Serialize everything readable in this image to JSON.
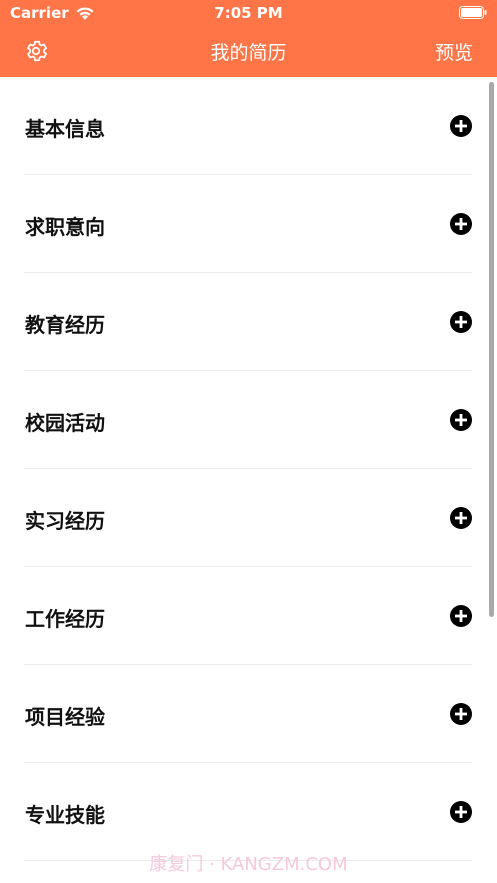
{
  "status_bar": {
    "carrier": "Carrier",
    "time": "7:05 PM"
  },
  "nav": {
    "title": "我的简历",
    "preview_label": "预览"
  },
  "colors": {
    "header_bg": "#FF7548",
    "header_text": "#FFFFFF",
    "item_text": "#111111",
    "divider": "#ECECEC"
  },
  "icons": {
    "settings": "gear-icon",
    "add": "plus-circle-icon",
    "wifi": "wifi-icon",
    "battery": "battery-icon"
  },
  "sections": [
    {
      "label": "基本信息"
    },
    {
      "label": "求职意向"
    },
    {
      "label": "教育经历"
    },
    {
      "label": "校园活动"
    },
    {
      "label": "实习经历"
    },
    {
      "label": "工作经历"
    },
    {
      "label": "项目经验"
    },
    {
      "label": "专业技能"
    }
  ],
  "watermark": "康复门 · KANGZM.COM"
}
